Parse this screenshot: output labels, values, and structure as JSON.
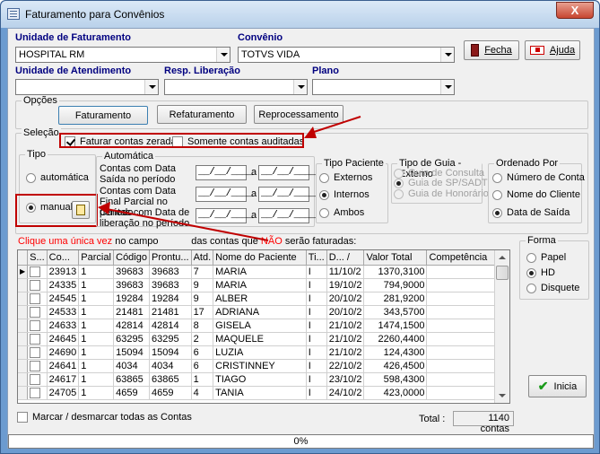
{
  "window": {
    "title": "Faturamento para Convênios",
    "close_label": "X"
  },
  "top": {
    "unidade_fat_label": "Unidade de Faturamento",
    "unidade_fat_value": "HOSPITAL RM",
    "convenio_label": "Convênio",
    "convenio_value": "TOTVS VIDA",
    "fecha_label": "Fecha",
    "ajuda_label": "Ajuda",
    "unidade_atend_label": "Unidade de Atendimento",
    "resp_label": "Resp. Liberação",
    "plano_label": "Plano"
  },
  "opcoes": {
    "title": "Opções",
    "faturamento": "Faturamento",
    "refaturamento": "Refaturamento",
    "reprocessamento": "Reprocessamento"
  },
  "selecao": {
    "title": "Seleção",
    "faturar_zeradas": "Faturar contas zeradas",
    "somente_auditadas": "Somente contas auditadas",
    "tipo_title": "Tipo",
    "automatica": "automática",
    "manual": "manual",
    "auto_title": "Automática",
    "saida_label": "Contas com Data Saída no período",
    "final_label": "Contas com Data Final Parcial no período",
    "liberacao_label": "Contas com Data de liberação no período",
    "date_placeholder": "__/__/____",
    "a": "a",
    "tipo_paciente_title": "Tipo Paciente",
    "externos": "Externos",
    "internos": "Internos",
    "ambos": "Ambos",
    "tipo_guia_title": "Tipo de Guia - Externo",
    "guia_consulta": "Guia de Consulta",
    "guia_sp": "Guia de SP/SADT",
    "guia_honorario": "Guia de Honorário",
    "ordenado_title": "Ordenado Por",
    "numero_conta": "Número de Conta",
    "nome_cliente": "Nome do Cliente",
    "data_saida": "Data de Saída"
  },
  "hint": {
    "part1": "Clique uma única vez",
    "part2": "no campo",
    "part3": "das contas que",
    "part4": "NÃO",
    "part5": "serão faturadas:"
  },
  "table": {
    "headers": [
      "S...",
      "Co...",
      "Parcial",
      "Código",
      "Prontu...",
      "Atd.",
      "Nome do Paciente",
      "Ti...",
      "D... /",
      "Valor Total",
      "Competência"
    ],
    "rows": [
      [
        "",
        "23913",
        "1",
        "39683",
        "39683",
        "7",
        "MARIA",
        "I",
        "11/10/2",
        "1370,3100",
        ""
      ],
      [
        "",
        "24335",
        "1",
        "39683",
        "39683",
        "9",
        "MARIA",
        "I",
        "19/10/2",
        "794,9000",
        ""
      ],
      [
        "",
        "24545",
        "1",
        "19284",
        "19284",
        "9",
        "ALBER",
        "I",
        "20/10/2",
        "281,9200",
        ""
      ],
      [
        "",
        "24533",
        "1",
        "21481",
        "21481",
        "17",
        "ADRIANA",
        "I",
        "20/10/2",
        "343,5700",
        ""
      ],
      [
        "",
        "24633",
        "1",
        "42814",
        "42814",
        "8",
        "GISELA",
        "I",
        "21/10/2",
        "1474,1500",
        ""
      ],
      [
        "",
        "24645",
        "1",
        "63295",
        "63295",
        "2",
        "MAQUELE",
        "I",
        "21/10/2",
        "2260,4400",
        ""
      ],
      [
        "",
        "24690",
        "1",
        "15094",
        "15094",
        "6",
        "LUZIA",
        "I",
        "21/10/2",
        "124,4300",
        ""
      ],
      [
        "",
        "24641",
        "1",
        "4034",
        "4034",
        "6",
        "CRISTINNEY",
        "I",
        "22/10/2",
        "426,4500",
        ""
      ],
      [
        "",
        "24617",
        "1",
        "63865",
        "63865",
        "1",
        "TIAGO",
        "I",
        "23/10/2",
        "598,4300",
        ""
      ],
      [
        "",
        "24705",
        "1",
        "4659",
        "4659",
        "4",
        "TANIA",
        "I",
        "24/10/2",
        "423,0000",
        ""
      ]
    ]
  },
  "forma": {
    "title": "Forma",
    "papel": "Papel",
    "hd": "HD",
    "disquete": "Disquete"
  },
  "inicia_label": "Inicia",
  "footer": {
    "marcar_label": "Marcar / desmarcar todas as Contas",
    "total_label": "Total :",
    "total_value": "1140 contas",
    "progress": "0%"
  },
  "colors": {
    "title_blue": "#000080",
    "hint_red": "#ff0000",
    "annotation_red": "#c00000"
  }
}
